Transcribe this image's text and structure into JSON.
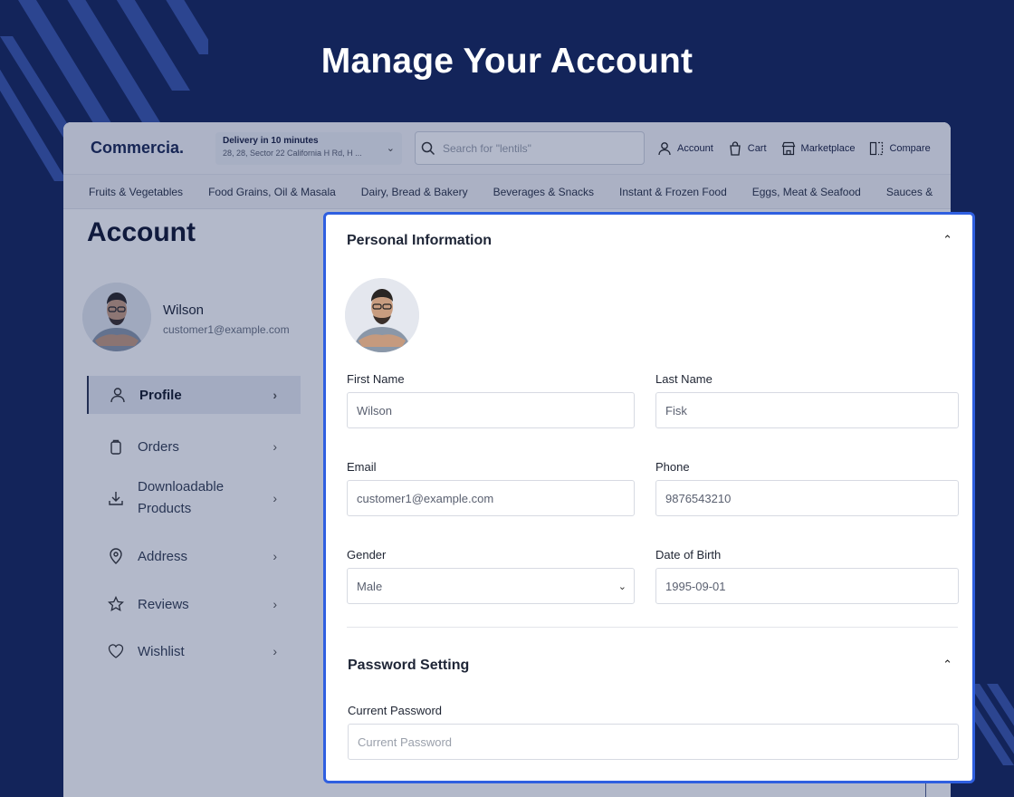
{
  "hero": {
    "title": "Manage Your Account"
  },
  "app": {
    "logo": "Commercia.",
    "delivery": {
      "title": "Delivery in 10 minutes",
      "address": "28, 28, Sector 22 California H Rd, H ..."
    },
    "search": {
      "placeholder": "Search for \"lentils\""
    },
    "nav": {
      "account": "Account",
      "cart": "Cart",
      "marketplace": "Marketplace",
      "compare": "Compare"
    },
    "categories": [
      "Fruits & Vegetables",
      "Food Grains, Oil & Masala",
      "Dairy, Bread & Bakery",
      "Beverages & Snacks",
      "Instant & Frozen Food",
      "Eggs, Meat & Seafood",
      "Sauces &"
    ]
  },
  "sidebar": {
    "title": "Account",
    "user": {
      "name": "Wilson",
      "email": "customer1@example.com"
    },
    "menu": [
      {
        "label": "Profile",
        "icon": "user-icon",
        "active": true
      },
      {
        "label": "Orders",
        "icon": "bag-icon"
      },
      {
        "label": "Downloadable Products",
        "icon": "download-icon"
      },
      {
        "label": "Address",
        "icon": "location-pin-icon"
      },
      {
        "label": "Reviews",
        "icon": "star-icon"
      },
      {
        "label": "Wishlist",
        "icon": "heart-icon"
      }
    ]
  },
  "personal": {
    "title": "Personal Information",
    "first_name": {
      "label": "First Name",
      "value": "Wilson"
    },
    "last_name": {
      "label": "Last Name",
      "value": "Fisk"
    },
    "email": {
      "label": "Email",
      "value": "customer1@example.com"
    },
    "phone": {
      "label": "Phone",
      "value": "9876543210"
    },
    "gender": {
      "label": "Gender",
      "value": "Male"
    },
    "dob": {
      "label": "Date of Birth",
      "value": "1995-09-01"
    }
  },
  "password": {
    "title": "Password Setting",
    "current": {
      "label": "Current Password",
      "placeholder": "Current Password"
    }
  },
  "colors": {
    "background": "#13245a",
    "accent": "#2f5fe0"
  }
}
